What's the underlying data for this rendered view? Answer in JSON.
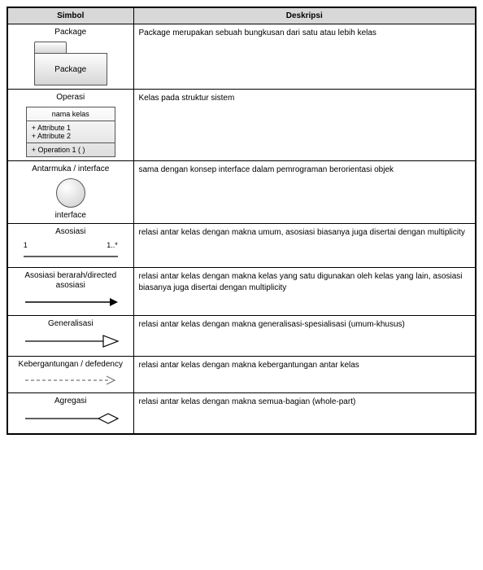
{
  "header": {
    "col1": "Simbol",
    "col2": "Deskripsi"
  },
  "rows": [
    {
      "label": "Package",
      "pkg_text": "Package",
      "desc": "Package merupakan sebuah bungkusan dari satu atau lebih kelas"
    },
    {
      "label": "Operasi",
      "cls_name": "nama kelas",
      "attr1": "+ Attribute  1",
      "attr2": "+ Attribute  2",
      "op1": "+ Operation  1 ( )",
      "desc": "Kelas pada struktur sistem"
    },
    {
      "label": "Antarmuka / interface",
      "sub": "interface",
      "desc": "sama dengan konsep interface dalam pemrograman berorientasi objek"
    },
    {
      "label": "Asosiasi",
      "mult_left": "1",
      "mult_right": "1..*",
      "desc": "relasi antar kelas dengan makna umum, asosiasi biasanya juga disertai dengan multiplicity"
    },
    {
      "label": "Asosiasi berarah/directed asosiasi",
      "desc": "relasi antar kelas dengan makna kelas yang satu digunakan oleh kelas yang lain, asosiasi biasanya juga disertai dengan multiplicity"
    },
    {
      "label": "Generalisasi",
      "desc": "relasi antar kelas dengan makna generalisasi-spesialisasi (umum-khusus)"
    },
    {
      "label": "Kebergantungan / defedency",
      "desc": "relasi antar kelas dengan makna kebergantungan antar kelas"
    },
    {
      "label": "Agregasi",
      "desc": "relasi antar kelas dengan makna semua-bagian (whole-part)"
    }
  ]
}
